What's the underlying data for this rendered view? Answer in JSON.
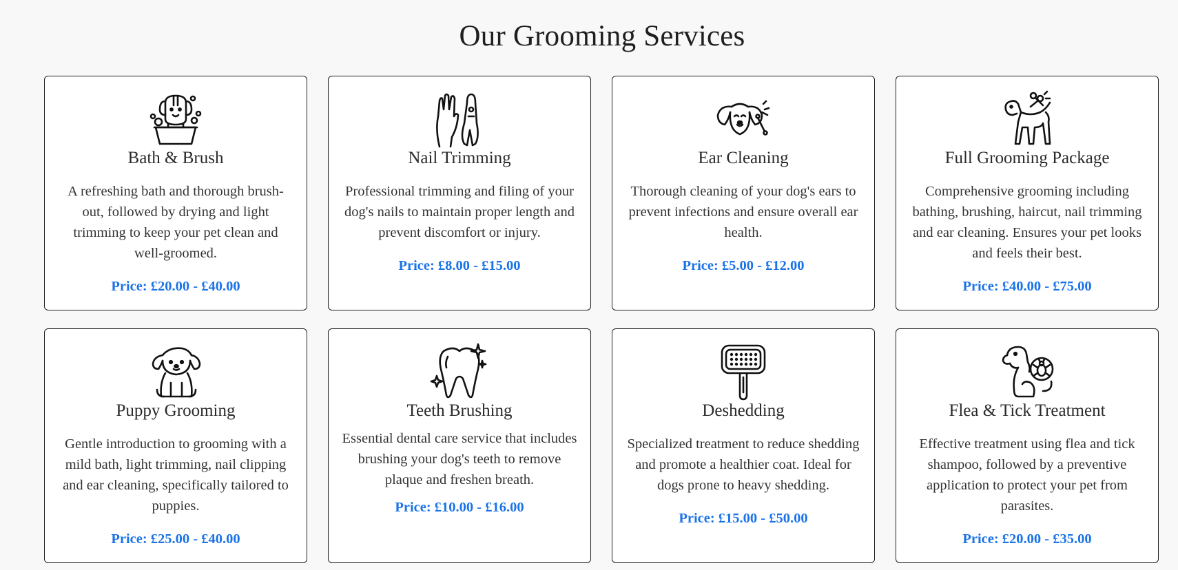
{
  "page": {
    "title": "Our Grooming Services"
  },
  "colors": {
    "price": "#1a73e8",
    "border": "#1e1e1e",
    "background": "#f8f8f8"
  },
  "services": [
    {
      "icon": "dog-bath-icon",
      "title": "Bath & Brush",
      "description": "A refreshing bath and thorough brush-out, followed by drying and light trimming to keep your pet clean and well-groomed.",
      "price": "Price: £20.00 - £40.00"
    },
    {
      "icon": "paw-nail-clipper-icon",
      "title": "Nail Trimming",
      "description": "Professional trimming and filing of your dog's nails to maintain proper length and prevent discomfort or injury.",
      "price": "Price: £8.00 - £15.00"
    },
    {
      "icon": "dog-ear-swab-icon",
      "title": "Ear Cleaning",
      "description": "Thorough cleaning of your dog's ears to prevent infections and ensure overall ear health.",
      "price": "Price: £5.00 - £12.00"
    },
    {
      "icon": "dog-scissors-icon",
      "title": "Full Grooming Package",
      "description": "Comprehensive grooming including bathing, brushing, haircut, nail trimming and ear cleaning. Ensures your pet looks and feels their best.",
      "price": "Price: £40.00 - £75.00"
    },
    {
      "icon": "puppy-icon",
      "title": "Puppy Grooming",
      "description": "Gentle introduction to grooming with a mild bath, light trimming, nail clipping and ear cleaning, specifically tailored to puppies.",
      "price": "Price: £25.00 - £40.00"
    },
    {
      "icon": "sparkling-tooth-icon",
      "title": "Teeth Brushing",
      "description": "Essential dental care service that includes brushing your dog's teeth to remove plaque and freshen breath.",
      "price": "Price: £10.00 - £16.00"
    },
    {
      "icon": "deshedding-brush-icon",
      "title": "Deshedding",
      "description": "Specialized treatment to reduce shedding and promote a healthier coat. Ideal for dogs prone to heavy shedding.",
      "price": "Price: £15.00 - £50.00"
    },
    {
      "icon": "dog-flea-icon",
      "title": "Flea & Tick Treatment",
      "description": "Effective treatment using flea and tick shampoo, followed by a preventive application to protect your pet from parasites.",
      "price": "Price: £20.00 - £35.00"
    }
  ]
}
